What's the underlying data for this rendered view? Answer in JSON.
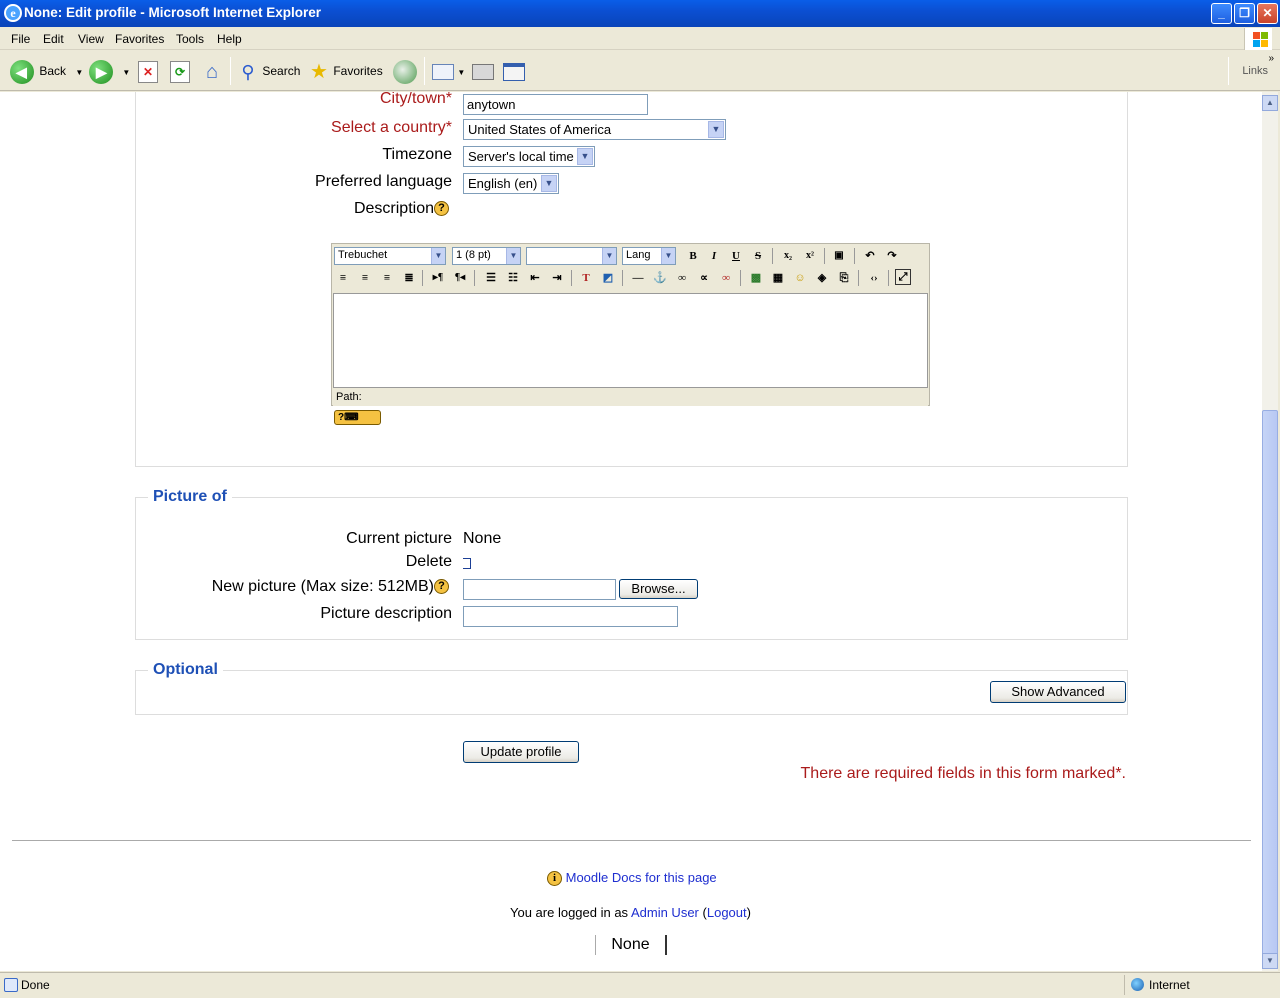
{
  "window": {
    "title": "None: Edit profile - Microsoft Internet Explorer",
    "minimize": "_",
    "maximize": "❐",
    "close": "✕"
  },
  "menu": [
    "File",
    "Edit",
    "View",
    "Favorites",
    "Tools",
    "Help"
  ],
  "toolbar": {
    "back": "Back",
    "search": "Search",
    "favorites": "Favorites",
    "links": "Links"
  },
  "form": {
    "city_label": "City/town*",
    "city_value": "anytown",
    "country_label": "Select a country*",
    "country_value": "United States of America",
    "timezone_label": "Timezone",
    "timezone_value": "Server's local time",
    "language_label": "Preferred language",
    "language_value": "English (en)",
    "description_label": "Description"
  },
  "editor": {
    "font": "Trebuchet",
    "size": "1 (8 pt)",
    "format": "",
    "lang": "Lang",
    "path_label": "Path:"
  },
  "picture": {
    "legend": "Picture of",
    "current_label": "Current picture",
    "current_value": "None",
    "delete_label": "Delete",
    "new_label": "New picture (Max size: 512MB)",
    "browse": "Browse...",
    "desc_label": "Picture description"
  },
  "optional": {
    "legend": "Optional",
    "show_advanced": "Show Advanced"
  },
  "submit": "Update profile",
  "required_note": "There are required fields in this form marked",
  "required_mark": "*.",
  "footer": {
    "docs_link": "Moodle Docs for this page",
    "logged_prefix": "You are logged in as",
    "user_link": "Admin User",
    "logout_link": "Logout",
    "course": "None"
  },
  "status": {
    "left": "Done",
    "zone": "Internet"
  },
  "colors": {
    "required": "#aa1b1b",
    "legend": "#1e50b6",
    "link": "#1e2ed0"
  }
}
